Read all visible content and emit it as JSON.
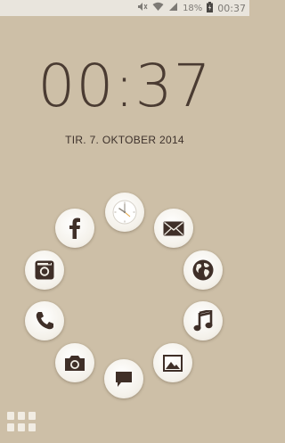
{
  "status_bar": {
    "battery_percent": "18%",
    "time": "00:37",
    "icons": [
      "mute-icon",
      "wifi-icon",
      "signal-icon",
      "battery-charging-icon"
    ]
  },
  "lockscreen": {
    "time": "00:37",
    "date": "TIR. 7. OKTOBER 2014"
  },
  "apps": [
    {
      "name": "clock-app",
      "icon": "clock-icon"
    },
    {
      "name": "email-app",
      "icon": "envelope-icon"
    },
    {
      "name": "browser-app",
      "icon": "globe-icon"
    },
    {
      "name": "music-app",
      "icon": "music-note-icon"
    },
    {
      "name": "gallery-app",
      "icon": "image-icon"
    },
    {
      "name": "messaging-app",
      "icon": "chat-bubble-icon"
    },
    {
      "name": "camera-app",
      "icon": "camera-icon"
    },
    {
      "name": "phone-app",
      "icon": "phone-icon"
    },
    {
      "name": "instagram-app",
      "icon": "instagram-icon"
    },
    {
      "name": "facebook-app",
      "icon": "facebook-icon"
    }
  ],
  "colors": {
    "background": "#cdbfa7",
    "icon_dark": "#3f2f28",
    "status_bar": "#e9e5dd"
  }
}
